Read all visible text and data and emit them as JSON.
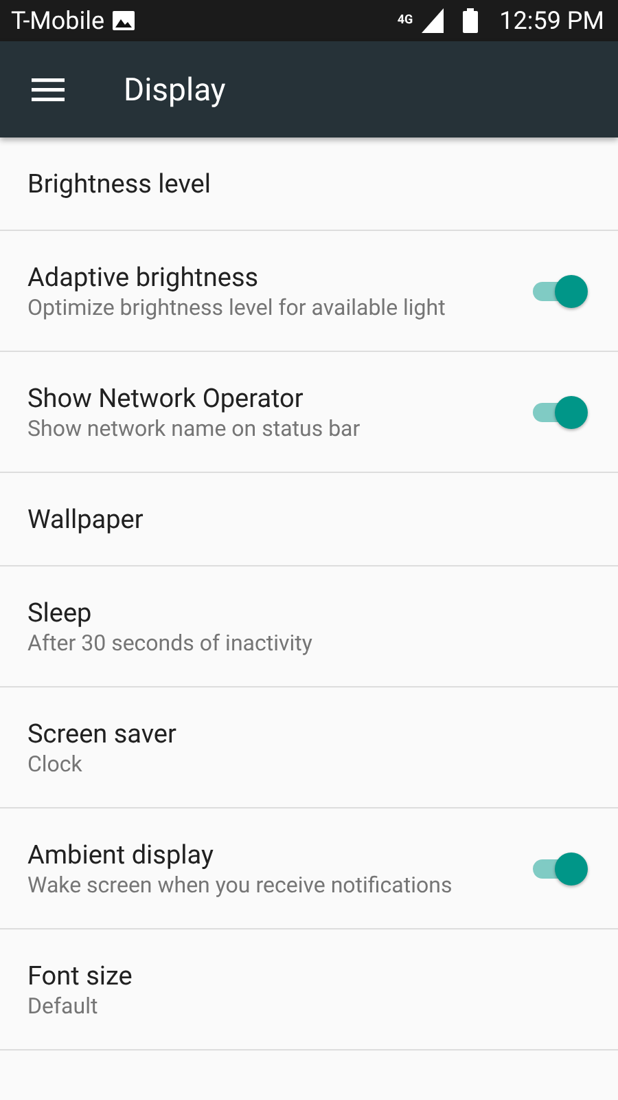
{
  "status_bar": {
    "carrier": "T-Mobile",
    "network": "4G",
    "time": "12:59 PM"
  },
  "app_bar": {
    "title": "Display"
  },
  "settings": [
    {
      "kind": "plain",
      "title": "Brightness level"
    },
    {
      "kind": "switch",
      "title": "Adaptive brightness",
      "subtitle": "Optimize brightness level for available light",
      "on": true
    },
    {
      "kind": "switch",
      "title": "Show Network Operator",
      "subtitle": "Show network name on status bar",
      "on": true
    },
    {
      "kind": "plain",
      "title": "Wallpaper"
    },
    {
      "kind": "plain",
      "title": "Sleep",
      "subtitle": "After 30 seconds of inactivity"
    },
    {
      "kind": "plain",
      "title": "Screen saver",
      "subtitle": "Clock"
    },
    {
      "kind": "switch",
      "title": "Ambient display",
      "subtitle": "Wake screen when you receive notifications",
      "on": true
    },
    {
      "kind": "plain",
      "title": "Font size",
      "subtitle": "Default"
    }
  ]
}
